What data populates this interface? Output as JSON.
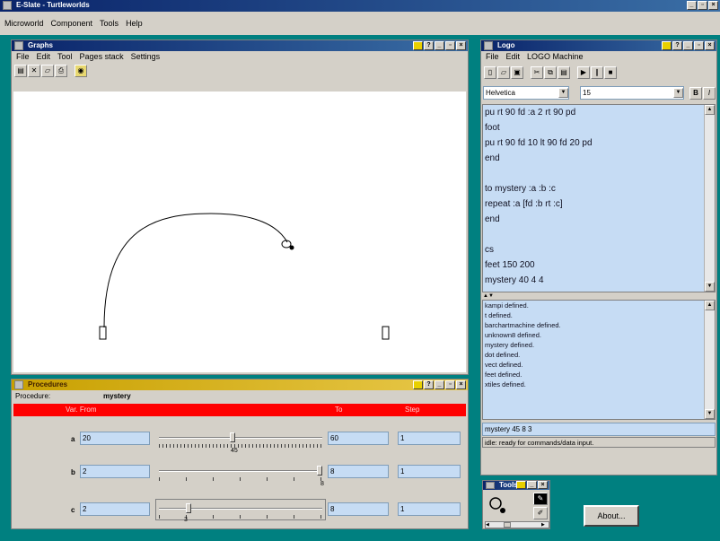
{
  "app": {
    "title": "E-Slate - Turtleworlds",
    "menu": [
      "Microworld",
      "Component",
      "Tools",
      "Help"
    ]
  },
  "graphics_window": {
    "title": "Graphs",
    "menu": [
      "File",
      "Edit",
      "Tool",
      "Pages stack",
      "Settings"
    ]
  },
  "logo_window": {
    "title": "Logo",
    "menu": [
      "File",
      "Edit",
      "LOGO Machine"
    ],
    "font_name": "Helvetica",
    "font_size": "15",
    "bold_label": "B",
    "italic_label": "I",
    "code_lines": [
      "pu rt 90 fd :a 2 rt 90 pd",
      "foot",
      "pu rt 90 fd 10 lt 90 fd 20 pd",
      "end",
      "",
      "to mystery :a :b :c",
      "repeat :a [fd :b rt :c]",
      "end",
      "",
      "cs",
      "feet 150 200",
      "mystery 40 4 4"
    ],
    "messages": [
      "kampi defined.",
      "t defined.",
      "barchartmachine defined.",
      "unknown8 defined.",
      "mystery defined.",
      "dot defined.",
      "vect defined.",
      "feet defined.",
      "xtiles defined."
    ],
    "command_input": "mystery 45 8 3",
    "status": "idle: ready for commands/data input."
  },
  "procedure_window": {
    "title": "Procedures",
    "procedure_label": "Procedure:",
    "procedure_name": "mystery",
    "header": {
      "var_from": "Var. From",
      "to": "To",
      "step": "Step"
    },
    "rows": [
      {
        "var": "a",
        "from": "20",
        "to": "60",
        "step": "1",
        "value": 45,
        "slider_value": 0.45,
        "tick_label": "45"
      },
      {
        "var": "b",
        "from": "2",
        "to": "8",
        "step": "1",
        "value": 8,
        "slider_value": 1.0,
        "tick_label": "8"
      },
      {
        "var": "c",
        "from": "2",
        "to": "8",
        "step": "1",
        "value": 3,
        "slider_value": 0.17,
        "tick_label": "3"
      }
    ]
  },
  "small_tool": {
    "title": "Tools"
  },
  "about_button": "About..."
}
